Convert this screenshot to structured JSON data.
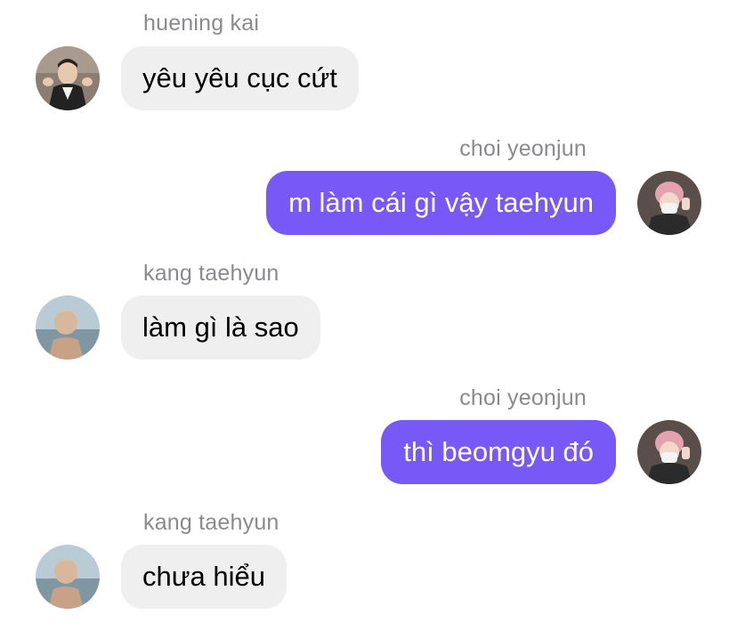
{
  "colors": {
    "incoming_bubble": "#efefef",
    "outgoing_bubble": "#7659f6",
    "sender_name": "#8a8a8e"
  },
  "messages": [
    {
      "sender": "huening kai",
      "text": "yêu yêu cục cứt",
      "direction": "incoming",
      "avatar": "huening-kai-avatar"
    },
    {
      "sender": "choi yeonjun",
      "text": "m làm cái gì vậy taehyun",
      "direction": "outgoing",
      "avatar": "choi-yeonjun-avatar"
    },
    {
      "sender": "kang taehyun",
      "text": "làm gì là sao",
      "direction": "incoming",
      "avatar": "kang-taehyun-avatar"
    },
    {
      "sender": "choi yeonjun",
      "text": "thì beomgyu đó",
      "direction": "outgoing",
      "avatar": "choi-yeonjun-avatar"
    },
    {
      "sender": "kang taehyun",
      "text": "chưa hiểu",
      "direction": "incoming",
      "avatar": "kang-taehyun-avatar"
    }
  ]
}
